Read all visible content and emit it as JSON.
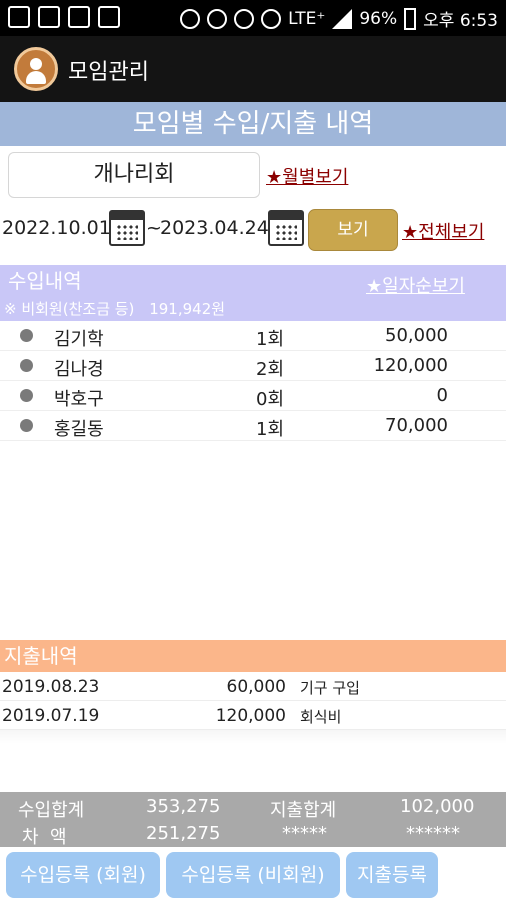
{
  "status_bar": {
    "battery": "96%",
    "network": "LTE⁺",
    "time": "오후 6:53"
  },
  "app": {
    "title": "모임관리"
  },
  "page": {
    "title": "모임별 수입/지출 내역"
  },
  "filter": {
    "group_name": "개나리회",
    "monthly_link": "★월별보기",
    "date_from": "2022.10.01",
    "date_sep": "~",
    "date_to": "2023.04.24",
    "view_button": "보기",
    "all_link": "★전체보기"
  },
  "income": {
    "title": "수입내역",
    "date_order_link": "★일자순보기",
    "nonmember_label": "※ 비회원(찬조금 등)",
    "nonmember_amount": "191,942원",
    "rows": [
      {
        "name": "김기학",
        "count": "1회",
        "amount": "50,000"
      },
      {
        "name": "김나경",
        "count": "2회",
        "amount": "120,000"
      },
      {
        "name": "박호구",
        "count": "0회",
        "amount": "0"
      },
      {
        "name": "홍길동",
        "count": "1회",
        "amount": "70,000"
      }
    ]
  },
  "expense": {
    "title": "지출내역",
    "rows": [
      {
        "date": "2019.08.23",
        "amount": "60,000",
        "memo": "기구 구입"
      },
      {
        "date": "2019.07.19",
        "amount": "120,000",
        "memo": "회식비"
      }
    ]
  },
  "totals": {
    "income_label": "수입합계",
    "income_value": "353,275",
    "expense_label": "지출합계",
    "expense_value": "102,000",
    "diff_label": "차  액",
    "diff_value": "251,275",
    "mask1": "*****",
    "mask2": "******"
  },
  "buttons": {
    "income_member": "수입등록 (회원)",
    "income_nonmember": "수입등록 (비회원)",
    "expense": "지출등록"
  }
}
